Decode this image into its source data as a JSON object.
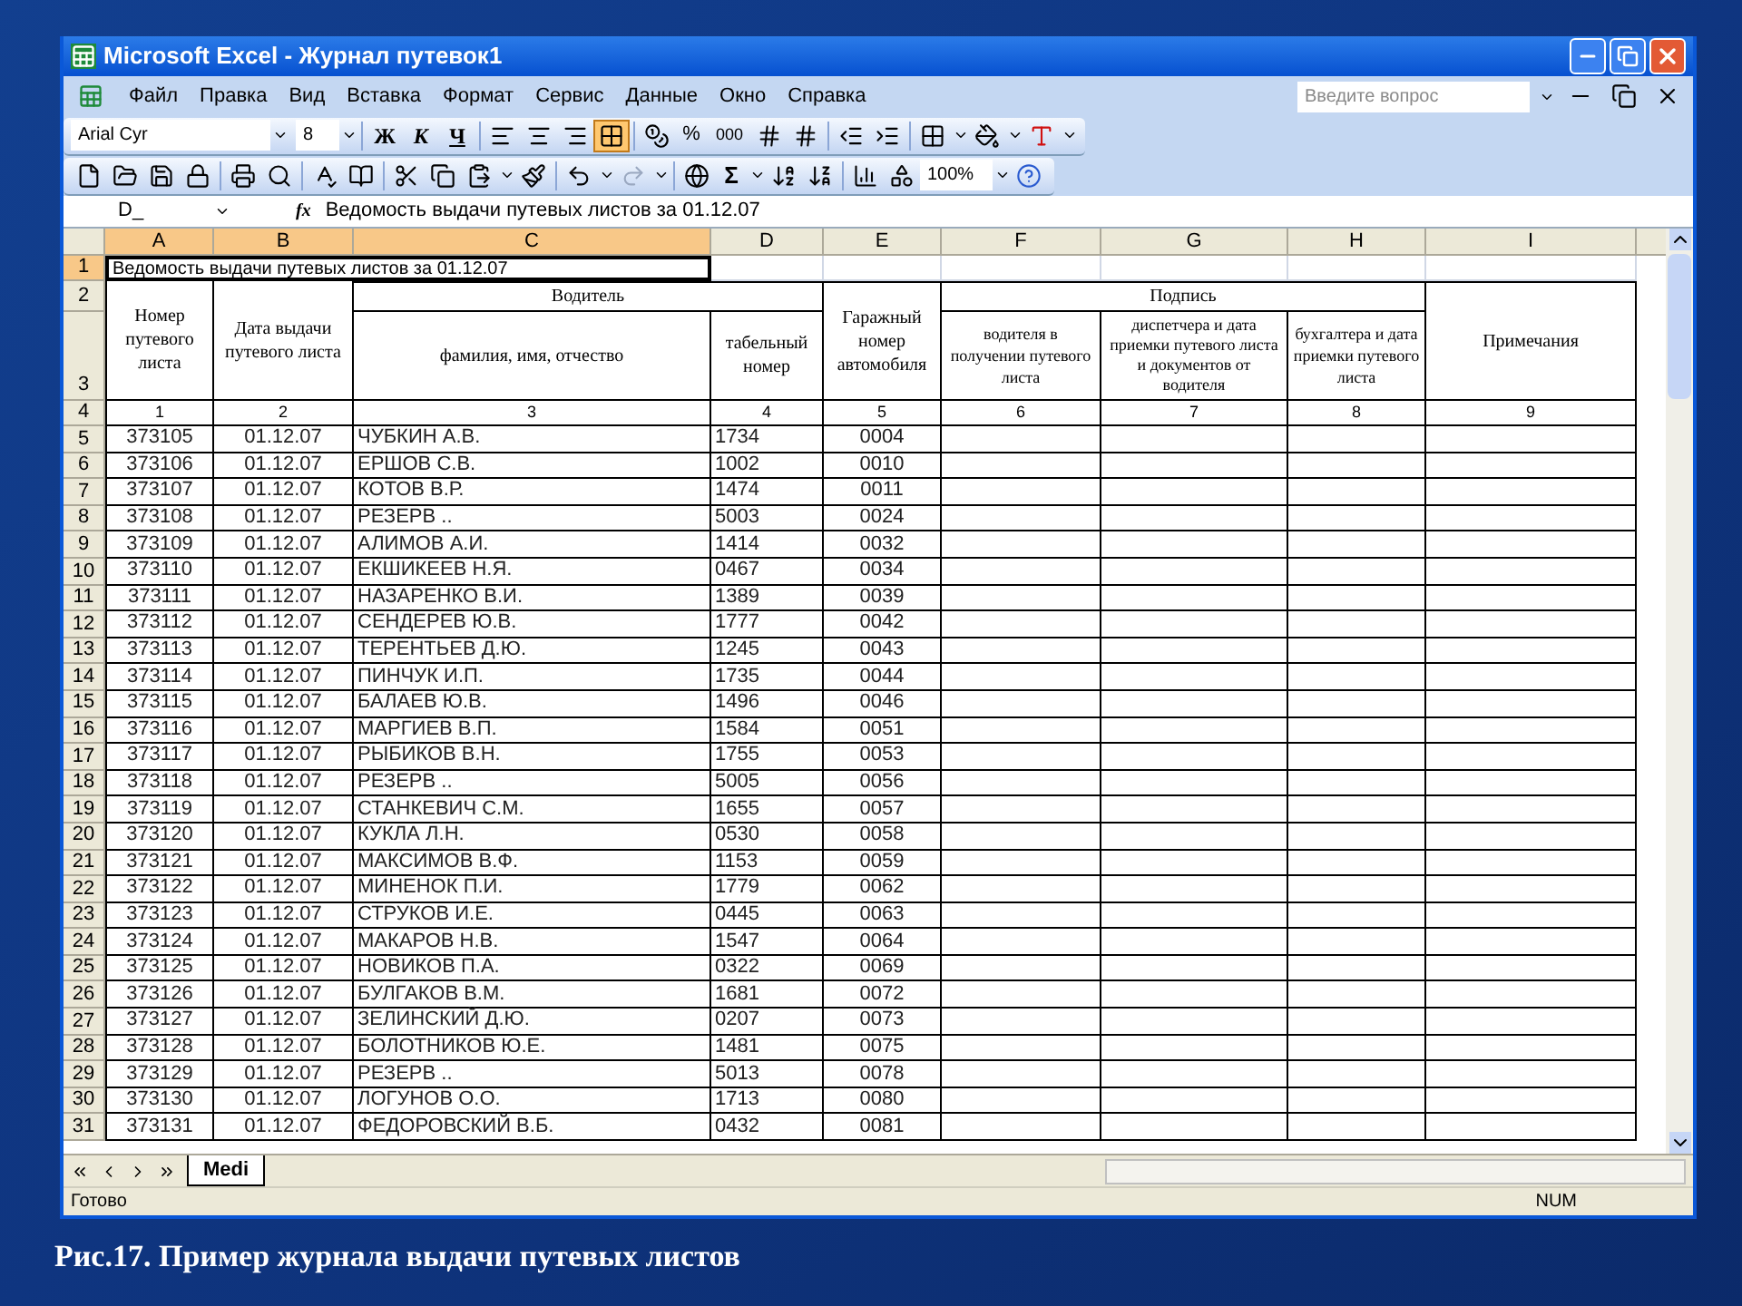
{
  "window": {
    "title": "Microsoft Excel - Журнал путевок1"
  },
  "menu": [
    "Файл",
    "Правка",
    "Вид",
    "Вставка",
    "Формат",
    "Сервис",
    "Данные",
    "Окно",
    "Справка"
  ],
  "help_box": {
    "placeholder": "Введите вопрос"
  },
  "format_toolbar": {
    "font": "Arial Cyr",
    "size": "8",
    "bold": "Ж",
    "italic": "К",
    "underline": "Ч",
    "percent": "%",
    "thousands": "000",
    "merge_pressed": true
  },
  "standard_toolbar": {
    "sum": "Σ",
    "zoom": "100%"
  },
  "formula_bar": {
    "name_box": "D_",
    "fx": "fx",
    "value": "Ведомость выдачи путевых листов за 01.12.07"
  },
  "columns": [
    {
      "label": "A",
      "selected": true
    },
    {
      "label": "B",
      "selected": true
    },
    {
      "label": "C",
      "selected": true
    },
    {
      "label": "D",
      "selected": false
    },
    {
      "label": "E",
      "selected": false
    },
    {
      "label": "F",
      "selected": false
    },
    {
      "label": "G",
      "selected": false
    },
    {
      "label": "H",
      "selected": false
    },
    {
      "label": "I",
      "selected": false
    }
  ],
  "title_row": {
    "number": "1",
    "selected": true,
    "text": "Ведомость выдачи путевых листов за 01.12.07"
  },
  "header_row_numbers": [
    "2",
    "3"
  ],
  "header": {
    "sheet_no": "Номер путевого листа",
    "issue_date": "Дата выдачи путевого листа",
    "driver": "Водитель",
    "full_name": "фамилия, имя, отчество",
    "personnel_no": "табельный номер",
    "garage_no": "Гаражный номер автомобиля",
    "signature": "Подпись",
    "sig_driver": "водителя в получении путевого листа",
    "sig_dispatcher": "диспетчера и дата приемки путевого листа и документов от водителя",
    "sig_accountant": "бухгалтера и дата приемки путевого листа",
    "notes": "Примечания"
  },
  "index_row": {
    "number": "4",
    "cells": [
      "1",
      "2",
      "3",
      "4",
      "5",
      "6",
      "7",
      "8",
      "9"
    ]
  },
  "rows": [
    {
      "number": "5",
      "cells": [
        "373105",
        "01.12.07",
        "ЧУБКИН А.В.",
        "1734",
        "0004"
      ]
    },
    {
      "number": "6",
      "cells": [
        "373106",
        "01.12.07",
        "ЕРШОВ С.В.",
        "1002",
        "0010"
      ]
    },
    {
      "number": "7",
      "cells": [
        "373107",
        "01.12.07",
        "КОТОВ В.Р.",
        "1474",
        "0011"
      ]
    },
    {
      "number": "8",
      "cells": [
        "373108",
        "01.12.07",
        "РЕЗЕРВ ..",
        "5003",
        "0024"
      ]
    },
    {
      "number": "9",
      "cells": [
        "373109",
        "01.12.07",
        "АЛИМОВ А.И.",
        "1414",
        "0032"
      ]
    },
    {
      "number": "10",
      "cells": [
        "373110",
        "01.12.07",
        "ЕКШИКЕЕВ Н.Я.",
        "0467",
        "0034"
      ]
    },
    {
      "number": "11",
      "cells": [
        "373111",
        "01.12.07",
        "НАЗАРЕНКО В.И.",
        "1389",
        "0039"
      ]
    },
    {
      "number": "12",
      "cells": [
        "373112",
        "01.12.07",
        "СЕНДЕРЕВ Ю.В.",
        "1777",
        "0042"
      ]
    },
    {
      "number": "13",
      "cells": [
        "373113",
        "01.12.07",
        "ТЕРЕНТЬЕВ Д.Ю.",
        "1245",
        "0043"
      ]
    },
    {
      "number": "14",
      "cells": [
        "373114",
        "01.12.07",
        "ПИНЧУК И.П.",
        "1735",
        "0044"
      ]
    },
    {
      "number": "15",
      "cells": [
        "373115",
        "01.12.07",
        "БАЛАЕВ Ю.В.",
        "1496",
        "0046"
      ]
    },
    {
      "number": "16",
      "cells": [
        "373116",
        "01.12.07",
        "МАРГИЕВ В.П.",
        "1584",
        "0051"
      ]
    },
    {
      "number": "17",
      "cells": [
        "373117",
        "01.12.07",
        "РЫБИКОВ В.Н.",
        "1755",
        "0053"
      ]
    },
    {
      "number": "18",
      "cells": [
        "373118",
        "01.12.07",
        "РЕЗЕРВ ..",
        "5005",
        "0056"
      ]
    },
    {
      "number": "19",
      "cells": [
        "373119",
        "01.12.07",
        "СТАНКЕВИЧ С.М.",
        "1655",
        "0057"
      ]
    },
    {
      "number": "20",
      "cells": [
        "373120",
        "01.12.07",
        "КУКЛА Л.Н.",
        "0530",
        "0058"
      ]
    },
    {
      "number": "21",
      "cells": [
        "373121",
        "01.12.07",
        "МАКСИМОВ В.Ф.",
        "1153",
        "0059"
      ]
    },
    {
      "number": "22",
      "cells": [
        "373122",
        "01.12.07",
        "МИНЕНОК П.И.",
        "1779",
        "0062"
      ]
    },
    {
      "number": "23",
      "cells": [
        "373123",
        "01.12.07",
        "СТРУКОВ И.Е.",
        "0445",
        "0063"
      ]
    },
    {
      "number": "24",
      "cells": [
        "373124",
        "01.12.07",
        "МАКАРОВ Н.В.",
        "1547",
        "0064"
      ]
    },
    {
      "number": "25",
      "cells": [
        "373125",
        "01.12.07",
        "НОВИКОВ П.А.",
        "0322",
        "0069"
      ]
    },
    {
      "number": "26",
      "cells": [
        "373126",
        "01.12.07",
        "БУЛГАКОВ В.М.",
        "1681",
        "0072"
      ]
    },
    {
      "number": "27",
      "cells": [
        "373127",
        "01.12.07",
        "ЗЕЛИНСКИЙ Д.Ю.",
        "0207",
        "0073"
      ]
    },
    {
      "number": "28",
      "cells": [
        "373128",
        "01.12.07",
        "БОЛОТНИКОВ Ю.Е.",
        "1481",
        "0075"
      ]
    },
    {
      "number": "29",
      "cells": [
        "373129",
        "01.12.07",
        "РЕЗЕРВ ..",
        "5013",
        "0078"
      ]
    },
    {
      "number": "30",
      "cells": [
        "373130",
        "01.12.07",
        "ЛОГУНОВ О.О.",
        "1713",
        "0080"
      ]
    },
    {
      "number": "31",
      "cells": [
        "373131",
        "01.12.07",
        "ФЕДОРОВСКИЙ В.Б.",
        "0432",
        "0081"
      ]
    }
  ],
  "sheet_tabs": [
    {
      "label": "Medi",
      "selected": true
    }
  ],
  "status_bar": {
    "text": "Готово",
    "num": "NUM"
  },
  "caption": "Рис.17. Пример журнала выдачи путевых листов"
}
